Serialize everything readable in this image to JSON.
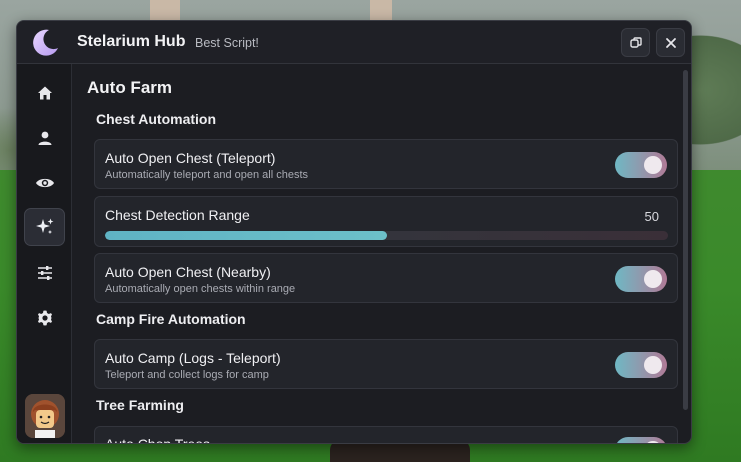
{
  "window": {
    "title": "Stelarium Hub",
    "subtitle": "Best Script!",
    "controls": {
      "restore_icon": "restore-icon",
      "close_icon": "close-icon"
    }
  },
  "sidebar": {
    "items": [
      {
        "icon": "home-icon",
        "active": false
      },
      {
        "icon": "user-icon",
        "active": false
      },
      {
        "icon": "eye-icon",
        "active": false
      },
      {
        "icon": "sparkle-icon",
        "active": true
      },
      {
        "icon": "sliders-icon",
        "active": false
      },
      {
        "icon": "gear-icon",
        "active": false
      }
    ],
    "avatar_icon": "avatar-icon"
  },
  "main": {
    "page_title": "Auto Farm",
    "sections": [
      {
        "label": "Chest Automation",
        "items": [
          {
            "type": "toggle",
            "title": "Auto Open Chest (Teleport)",
            "description": "Automatically teleport and open all chests",
            "enabled": true
          },
          {
            "type": "slider",
            "title": "Chest Detection Range",
            "value": "50",
            "fill_fraction": 0.5
          },
          {
            "type": "toggle",
            "title": "Auto Open Chest (Nearby)",
            "description": "Automatically open chests within range",
            "enabled": true
          }
        ]
      },
      {
        "label": "Camp Fire Automation",
        "items": [
          {
            "type": "toggle",
            "title": "Auto Camp (Logs - Teleport)",
            "description": "Teleport and collect logs for camp",
            "enabled": true
          }
        ]
      },
      {
        "label": "Tree Farming",
        "items": [
          {
            "type": "toggle",
            "title": "Auto Chop Trees",
            "description": "",
            "enabled": true
          }
        ]
      }
    ]
  },
  "colors": {
    "window_bg": "#1c1d22",
    "card_bg": "#23252b",
    "accent_start": "#6fb8c4",
    "accent_end": "#b07a96"
  }
}
